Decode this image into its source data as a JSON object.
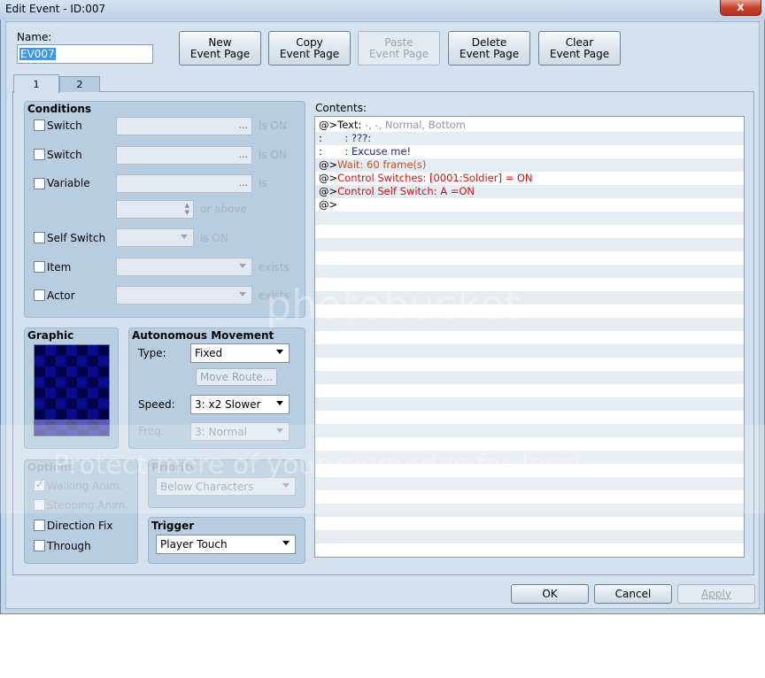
{
  "window": {
    "title": "Edit Event - ID:007",
    "close_glyph": "x"
  },
  "name_field": {
    "label": "Name:",
    "value": "EV007"
  },
  "toolbar": {
    "new_page": [
      "New",
      "Event Page"
    ],
    "copy_page": [
      "Copy",
      "Event Page"
    ],
    "paste_page": [
      "Paste",
      "Event Page"
    ],
    "delete_page": [
      "Delete",
      "Event Page"
    ],
    "clear_page": [
      "Clear",
      "Event Page"
    ]
  },
  "tabs": [
    {
      "label": "1",
      "selected": true
    },
    {
      "label": "2",
      "selected": false
    }
  ],
  "conditions": {
    "title": "Conditions",
    "switch1": {
      "label": "Switch",
      "suffix": "is ON",
      "value": ""
    },
    "switch2": {
      "label": "Switch",
      "suffix": "is ON",
      "value": ""
    },
    "variable": {
      "label": "Variable",
      "suffix": "is",
      "value": "",
      "threshold_suffix": "or above"
    },
    "self_switch": {
      "label": "Self Switch",
      "suffix": "is ON"
    },
    "item": {
      "label": "Item",
      "suffix": "exists"
    },
    "actor": {
      "label": "Actor",
      "suffix": "exists"
    },
    "more_glyph": "..."
  },
  "graphic": {
    "title": "Graphic"
  },
  "autonomous_movement": {
    "title": "Autonomous Movement",
    "type_label": "Type:",
    "type_value": "Fixed",
    "move_route_label": "Move Route...",
    "speed_label": "Speed:",
    "speed_value": "3: x2 Slower",
    "freq_label": "Freq:",
    "freq_value": "3: Normal"
  },
  "options": {
    "title": "Options",
    "walking_anim": {
      "label": "Walking Anim.",
      "checked": true,
      "enabled": false
    },
    "stepping_anim": {
      "label": "Stepping Anim.",
      "checked": false,
      "enabled": false
    },
    "direction_fix": {
      "label": "Direction Fix",
      "checked": false,
      "enabled": true
    },
    "through": {
      "label": "Through",
      "checked": false,
      "enabled": true
    }
  },
  "priority": {
    "title": "Priority",
    "value": "Below Characters"
  },
  "trigger": {
    "title": "Trigger",
    "value": "Player Touch"
  },
  "contents": {
    "label": "Contents:",
    "lines": [
      {
        "prefix": "@>",
        "text": "Text:",
        "detail": " -, -, Normal, Bottom",
        "color": "black",
        "detail_color": "gray"
      },
      {
        "prefix": " :",
        "text": "       : ???:",
        "detail": "",
        "color": "navy",
        "detail_color": "navy"
      },
      {
        "prefix": " :",
        "text": "       : Excuse me!",
        "detail": "",
        "color": "navy",
        "detail_color": "navy"
      },
      {
        "prefix": "@>",
        "text": "Wait: 60 frame(s)",
        "detail": "",
        "color": "orange",
        "detail_color": "orange"
      },
      {
        "prefix": "@>",
        "text": "Control Switches: [0001:Soldier] = ON",
        "detail": "",
        "color": "red",
        "detail_color": "red"
      },
      {
        "prefix": "@>",
        "text": "Control Self Switch: A =ON",
        "detail": "",
        "color": "red",
        "detail_color": "red"
      },
      {
        "prefix": "@>",
        "text": "",
        "detail": "",
        "color": "black",
        "detail_color": "black"
      }
    ]
  },
  "footer": {
    "ok_label": "OK",
    "cancel_label": "Cancel",
    "apply_label": "Apply"
  },
  "watermark": {
    "line1": "photobucket",
    "line2": "Protect more of your memories for less!"
  },
  "colors": {
    "window_bg": "#d4e1ee",
    "panel_bg": "#b9cde0",
    "selection": "#3399ff",
    "command_red": "#d01010",
    "command_navy": "#1a2a8a",
    "command_orange": "#c8501a"
  }
}
